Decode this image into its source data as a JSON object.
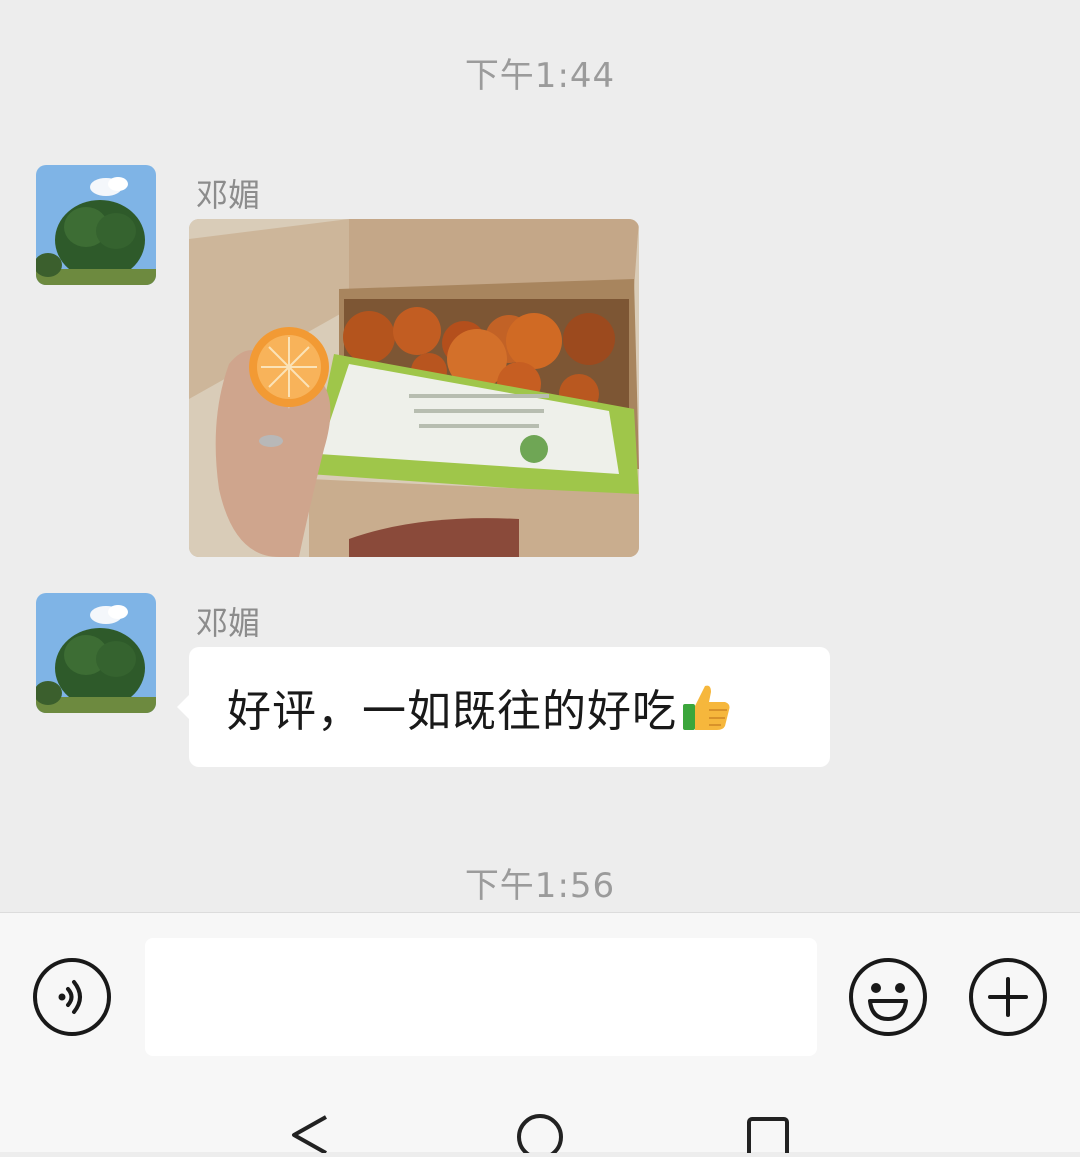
{
  "chat": {
    "timestamps": [
      "下午1:44",
      "下午1:56"
    ],
    "messages": [
      {
        "sender": "邓媚",
        "type": "image"
      },
      {
        "sender": "邓媚",
        "type": "text",
        "text": "好评，一如既往的好吃",
        "emoji": "thumbs-up-icon"
      }
    ]
  },
  "input_bar": {
    "value": "",
    "placeholder": ""
  },
  "colors": {
    "background": "#ededed",
    "bubble": "#ffffff",
    "timestamp": "#9b9b9b",
    "sender": "#8c8c8c"
  }
}
